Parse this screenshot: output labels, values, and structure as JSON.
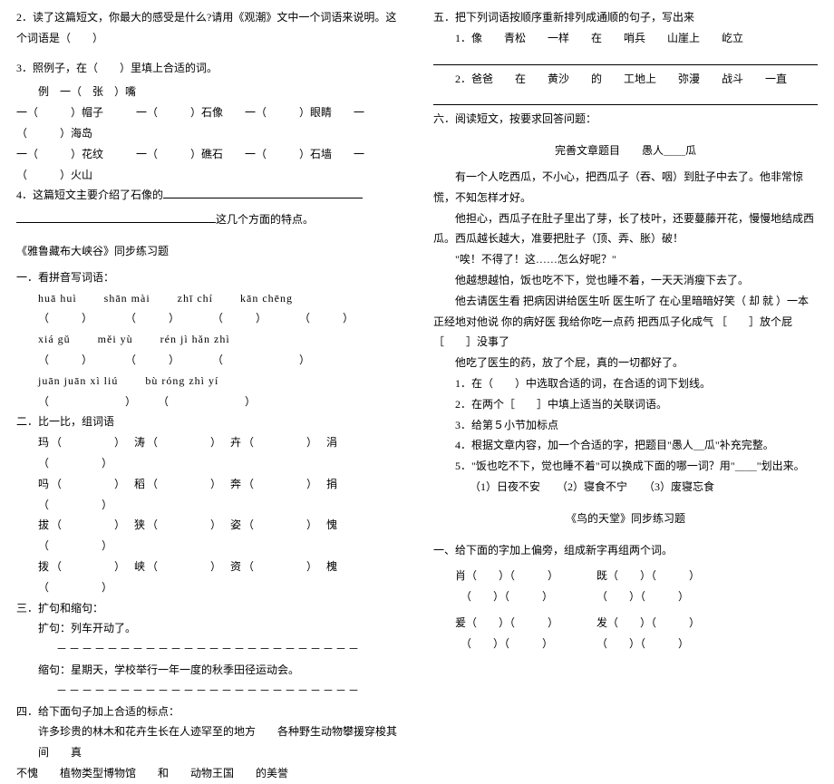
{
  "left": {
    "q2": "2．读了这篇短文，你最大的感受是什么?请用《观潮》文中一个词语来说明。这个词语是（　　）",
    "q3": "3．照例子，在（　　）里填上合适的词。",
    "q3_ex": "例　一（　张　）嘴",
    "q3_row1": "一（　　　）帽子　　　一（　　　）石像　　一（　　　）眼睛　　一（　　　）海岛",
    "q3_row2": "一（　　　）花纹　　　一（　　　）礁石　　一（　　　）石墙　　一（　　　）火山",
    "q4": "4．这篇短文主要介绍了石像的",
    "q4_tail": "这几个方面的特点。",
    "title1": "《雅鲁藏布大峡谷》同步练习题",
    "s1": "一．看拼音写词语：",
    "py1a": "huā huì",
    "py1b": "shān mài",
    "py1c": "zhī chí",
    "py1d": "kān chēng",
    "paren1": "（　　　）　　　　（　　　）　　　　（　　　）　　　　（　　　）",
    "py2a": "xiá gǔ",
    "py2b": "měi yù",
    "py2c": "rén jì hǎn zhì",
    "paren2": "（　　　）　　　　（　　　）　　　　（　　　　　　　）",
    "py3a": "juān juān xì liú",
    "py3b": "bù róng zhì yí",
    "paren3": "（　　　　　　　）　　　（　　　　　　　）",
    "s2": "二．比一比，组词语",
    "w1": "玛（　　　　）　涛（　　　　）　卉（　　　　）　涓（　　　　）",
    "w2": "吗（　　　　）　稻（　　　　）　奔（　　　　）　捐（　　　　）",
    "w3": "拔（　　　　）　狭（　　　　）　姿（　　　　）　愧（　　　　）",
    "w4": "拨（　　　　）　峡（　　　　）　资（　　　　）　槐（　　　　）",
    "s3": "三．扩句和缩句：",
    "s3_ext": "扩句：列车开动了。",
    "dashes": "－－－－－－－－－－－－－－－－－－－－－－－－",
    "s3_con": "缩句：星期天，学校举行一年一度的秋季田径运动会。",
    "s4": "四．给下面句子加上合适的标点：",
    "s4_text1": "许多珍贵的林木和花卉生长在人迹罕至的地方　　各种野生动物攀援穿梭其间　　真",
    "s4_text2": "不愧　　植物类型博物馆　　和　　动物王国　　的美誉"
  },
  "right": {
    "q5": "五．把下列词语按顺序重新排列成通顺的句子，写出来",
    "q5_1": "1．像　　青松　　一样　　在　　哨兵　　山崖上　　屹立",
    "q5_2": "2．爸爸　　在　　黄沙　　的　　工地上　　弥漫　　战斗　　一直",
    "q6": "六．阅读短文，按要求回答问题：",
    "passage_title": "完善文章题目　　愚人＿＿瓜",
    "p1": "有一个人吃西瓜，不小心，把西瓜子（吞、咽）到肚子中去了。他非常惊慌，不知怎样才好。",
    "p2": "他担心，西瓜子在肚子里出了芽，长了枝叶，还要蔓藤开花，慢慢地结成西瓜。西瓜越长越大，准要把肚子（顶、弄、胀）破！",
    "p3": "\"唉！不得了！这……怎么好呢？\"",
    "p4": "他越想越怕，饭也吃不下，觉也睡不着，一天天消瘦下去了。",
    "p5": "他去请医生看 把病因讲给医生听 医生听了 在心里暗暗好笑（ 却 就 ）一本正经地对他说 你的病好医 我给你吃一点药 把西瓜子化成气 ［　　］放个屁 ［　　］没事了",
    "p6": "他吃了医生的药，放了个屁，真的一切都好了。",
    "r1": "1．在（　　）中选取合适的词，在合适的词下划线。",
    "r2": "2．在两个［　　］中填上适当的关联词语。",
    "r3": "3．给第５小节加标点",
    "r4": "4．根据文章内容，加一个合适的字，把题目\"愚人＿瓜\"补充完整。",
    "r5": "5．\"饭也吃不下，觉也睡不着\"可以换成下面的哪一词？用\"＿＿\"划出来。",
    "r5_opts": "（1）日夜不安　　（2）寝食不宁　　（3）废寝忘食",
    "title2": "《鸟的天堂》同步练习题",
    "b1": "一、给下面的字加上偏旁，组成新字再组两个词。",
    "c1a": "肖（　　）（　　　）　　　　既（　　）（　　　）",
    "c1b": "　（　　）（　　　）　　　　　（　　）（　　　）",
    "c2a": "爰（　　）（　　　）　　　　发（　　）（　　　）",
    "c2b": "　（　　）（　　　）　　　　　（　　）（　　　）"
  }
}
